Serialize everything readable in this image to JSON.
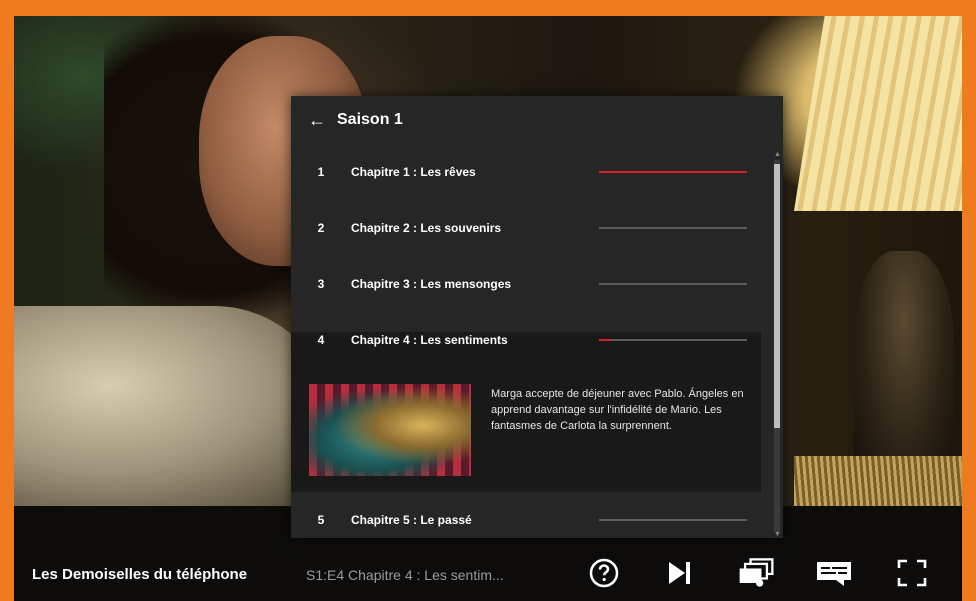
{
  "player": {
    "show_title": "Les Demoiselles du téléphone",
    "episode_info": "S1:E4  Chapitre 4 : Les sentim..."
  },
  "episodes_panel": {
    "season_title": "Saison 1",
    "episodes": [
      {
        "number": "1",
        "title": "Chapitre 1 : Les rêves",
        "progress": 1.0
      },
      {
        "number": "2",
        "title": "Chapitre 2 : Les souvenirs",
        "progress": 0.0
      },
      {
        "number": "3",
        "title": "Chapitre 3 : Les mensonges",
        "progress": 0.0
      },
      {
        "number": "4",
        "title": "Chapitre 4 : Les sentiments",
        "progress": 0.08
      },
      {
        "number": "5",
        "title": "Chapitre 5 : Le passé",
        "progress": 0.0
      }
    ],
    "expanded_synopsis": "Marga accepte de déjeuner avec Pablo. Ángeles en apprend davantage sur l'infidélité de Mario. Les fantasmes de Carlota la surprennent."
  },
  "controls": {
    "icons": [
      "help-icon",
      "next-episode-icon",
      "episodes-icon",
      "subtitles-icon",
      "fullscreen-icon"
    ]
  },
  "colors": {
    "frame": "#f07a1f",
    "accent": "#d81f26",
    "panel": "#262626"
  }
}
